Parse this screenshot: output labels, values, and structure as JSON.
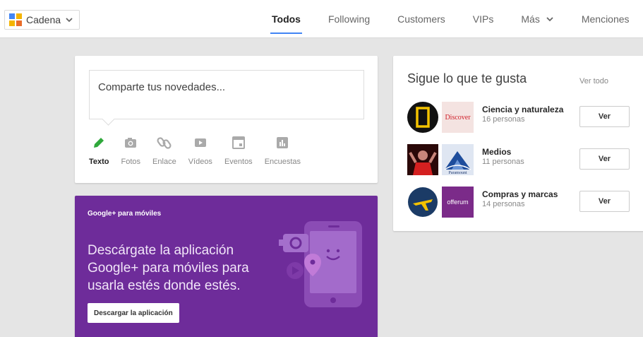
{
  "topbar": {
    "stream_label": "Cadena",
    "tabs": [
      {
        "label": "Todos",
        "active": true
      },
      {
        "label": "Following"
      },
      {
        "label": "Customers"
      },
      {
        "label": "VIPs"
      },
      {
        "label": "Más"
      },
      {
        "label": "Menciones"
      }
    ]
  },
  "share": {
    "placeholder": "Comparte tus novedades...",
    "actions": [
      {
        "label": "Texto",
        "icon": "pencil-icon"
      },
      {
        "label": "Fotos",
        "icon": "camera-icon"
      },
      {
        "label": "Enlace",
        "icon": "link-icon"
      },
      {
        "label": "Vídeos",
        "icon": "video-icon"
      },
      {
        "label": "Eventos",
        "icon": "calendar-icon"
      },
      {
        "label": "Encuestas",
        "icon": "poll-icon"
      }
    ]
  },
  "promo": {
    "heading": "Google+ para móviles",
    "text": "Descárgate la aplicación Google+ para móviles para usarla estés donde estés.",
    "button": "Descargar la aplicación",
    "color": "#6e2c9a"
  },
  "follow": {
    "title": "Sigue lo que te gusta",
    "view_all": "Ver todo",
    "items": [
      {
        "title": "Ciencia y naturaleza",
        "count": "16 personas",
        "button": "Ver",
        "logo_text": "Discover"
      },
      {
        "title": "Medios",
        "count": "11 personas",
        "button": "Ver",
        "logo_text": "Paramount"
      },
      {
        "title": "Compras y marcas",
        "count": "14 personas",
        "button": "Ver",
        "logo_text": "offerum"
      }
    ]
  },
  "colors": {
    "accent": "#4285f4",
    "text_active": "#3d8c3d"
  }
}
